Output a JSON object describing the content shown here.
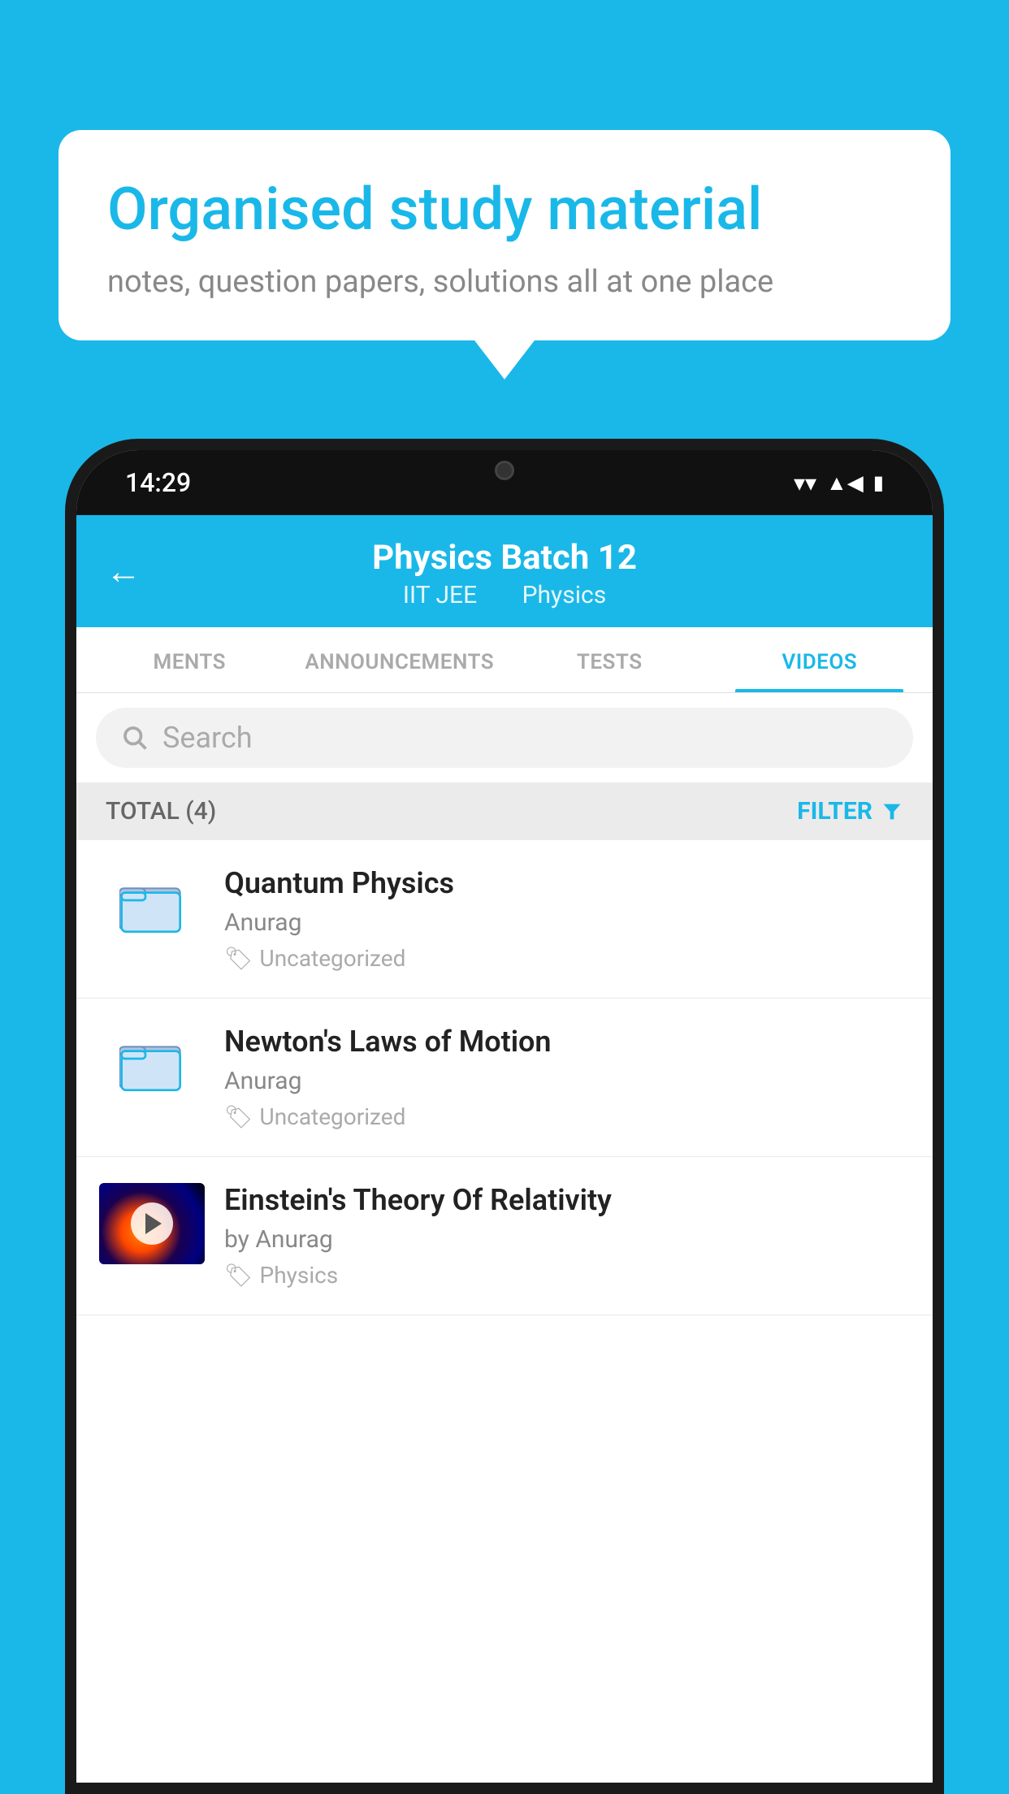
{
  "background_color": "#1ab8e8",
  "speech_bubble": {
    "title": "Organised study material",
    "subtitle": "notes, question papers, solutions all at one place"
  },
  "phone": {
    "status_bar": {
      "time": "14:29"
    },
    "header": {
      "back_label": "←",
      "title": "Physics Batch 12",
      "subtitle_part1": "IIT JEE",
      "subtitle_part2": "Physics"
    },
    "tabs": [
      {
        "label": "MENTS",
        "active": false
      },
      {
        "label": "ANNOUNCEMENTS",
        "active": false
      },
      {
        "label": "TESTS",
        "active": false
      },
      {
        "label": "VIDEOS",
        "active": true
      }
    ],
    "search": {
      "placeholder": "Search"
    },
    "filter_bar": {
      "total_label": "TOTAL (4)",
      "filter_label": "FILTER"
    },
    "videos": [
      {
        "id": 1,
        "title": "Quantum Physics",
        "author": "Anurag",
        "tag": "Uncategorized",
        "has_thumbnail": false
      },
      {
        "id": 2,
        "title": "Newton's Laws of Motion",
        "author": "Anurag",
        "tag": "Uncategorized",
        "has_thumbnail": false
      },
      {
        "id": 3,
        "title": "Einstein's Theory Of Relativity",
        "author": "by Anurag",
        "tag": "Physics",
        "has_thumbnail": true
      }
    ]
  }
}
